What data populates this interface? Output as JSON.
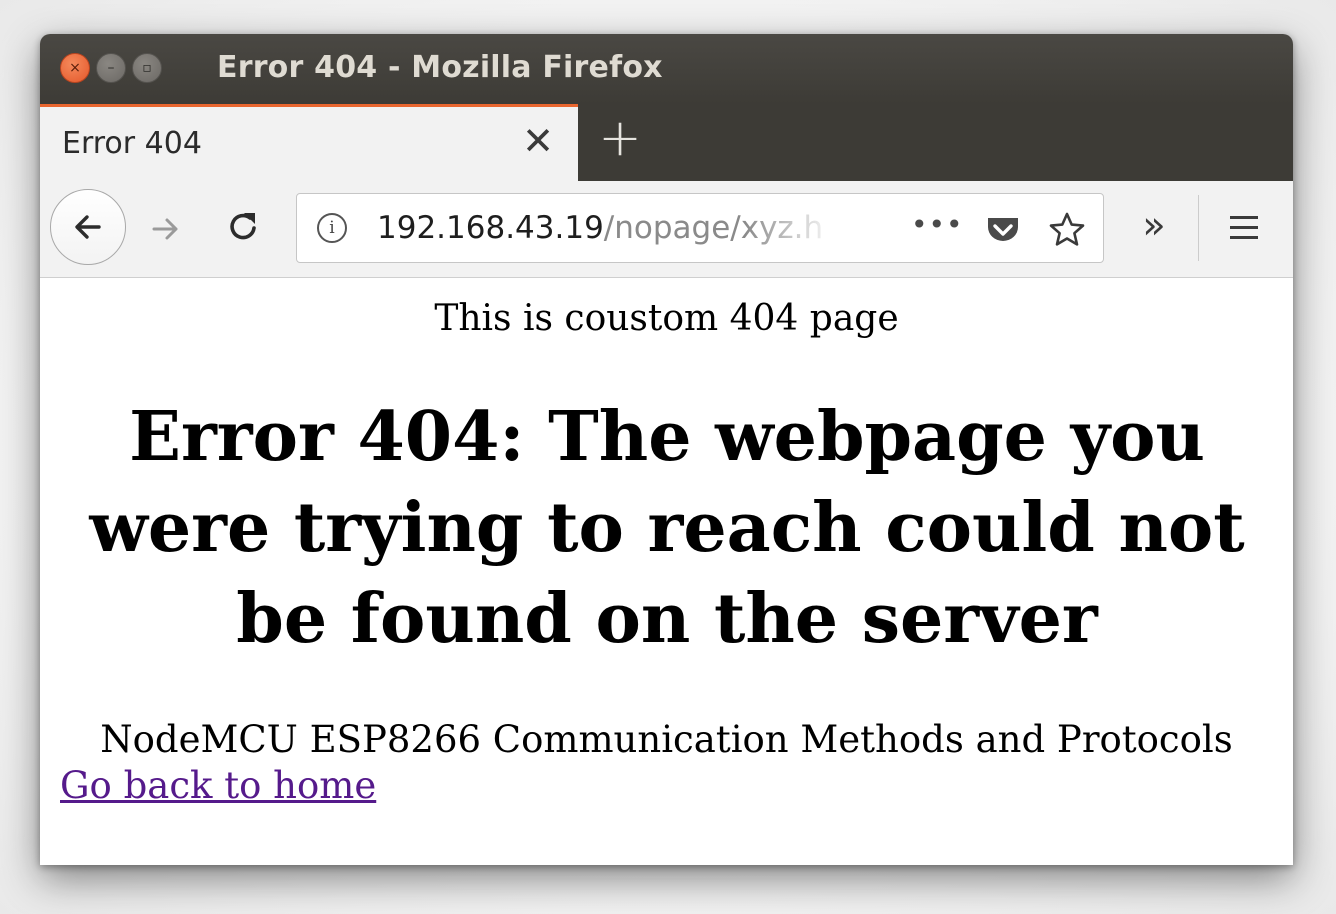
{
  "window": {
    "title": "Error 404 - Mozilla Firefox",
    "controls": {
      "close_glyph": "×",
      "minimize_glyph": "–",
      "maximize_glyph": "▫"
    }
  },
  "tabs": [
    {
      "label": "Error 404",
      "active": true,
      "close_glyph": "✕"
    }
  ],
  "new_tab_glyph": "+",
  "toolbar": {
    "back_icon": "arrow-left-icon",
    "forward_icon": "arrow-right-icon",
    "reload_icon": "reload-icon",
    "url_host": "192.168.43.19",
    "url_path": "/nopage/xyz.h",
    "info_glyph": "i",
    "page_actions_glyph": "•••",
    "pocket_icon": "pocket-icon",
    "bookmark_icon": "star-icon",
    "overflow_glyph": "»",
    "menu_icon": "hamburger-menu-icon"
  },
  "page": {
    "custom_line": "This is coustom 404 page",
    "heading": "Error 404: The webpage you were trying to reach could not be found on the server",
    "footer_line": "NodeMCU ESP8266 Communication Methods and Protocols",
    "home_link": "Go back to home"
  },
  "colors": {
    "titlebar": "#3d3b36",
    "tab_accent": "#e9662f",
    "visited_link": "#551a8b",
    "url_path": "#8a8a8a"
  }
}
